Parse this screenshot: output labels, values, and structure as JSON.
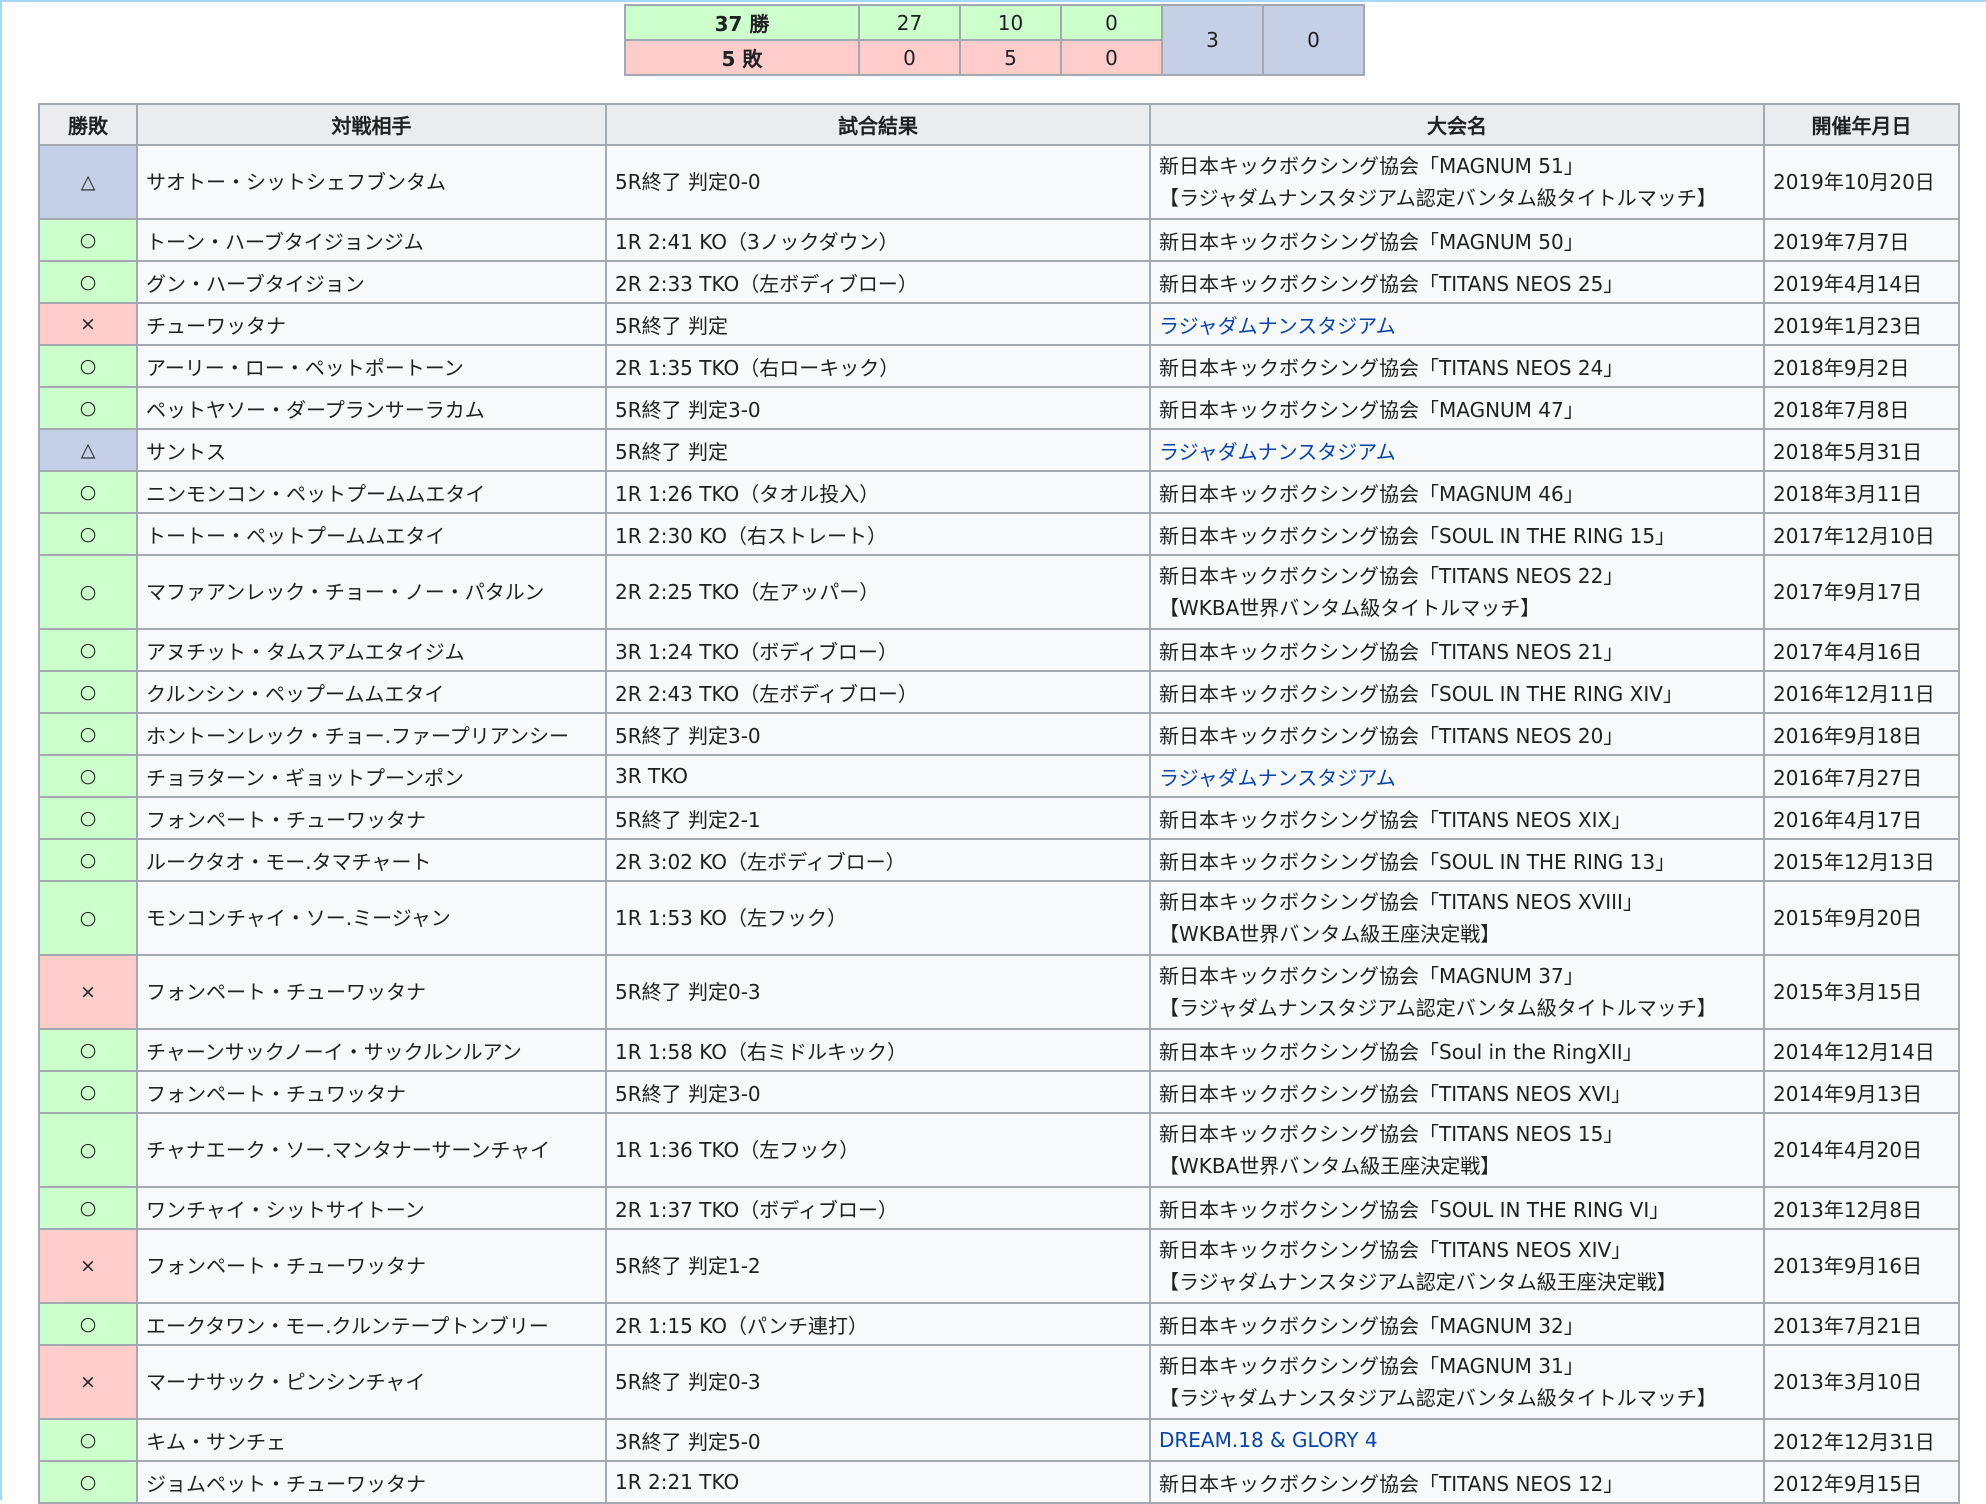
{
  "summary": {
    "wins_label": "37 勝",
    "wins_values": [
      "27",
      "10",
      "0"
    ],
    "losses_label": "5 敗",
    "losses_values": [
      "0",
      "5",
      "0"
    ],
    "draws": "3",
    "no_contest": "0"
  },
  "headers": [
    "勝敗",
    "対戦相手",
    "試合結果",
    "大会名",
    "開催年月日"
  ],
  "rows": [
    {
      "result": "△",
      "type": "d",
      "opponent": "サオトー・シットシェフブンタム",
      "outcome": "5R終了 判定0-0",
      "event": "新日本キックボクシング協会「MAGNUM 51」",
      "event_sub": "【ラジャダムナンスタジアム認定バンタム級タイトルマッチ】",
      "link": false,
      "date": "2019年10月20日"
    },
    {
      "result": "○",
      "type": "w",
      "opponent": "トーン・ハーブタイジョンジム",
      "outcome": "1R 2:41 KO（3ノックダウン）",
      "event": "新日本キックボクシング協会「MAGNUM 50」",
      "event_sub": "",
      "link": false,
      "date": "2019年7月7日"
    },
    {
      "result": "○",
      "type": "w",
      "opponent": "グン・ハーブタイジョン",
      "outcome": "2R 2:33 TKO（左ボディブロー）",
      "event": "新日本キックボクシング協会「TITANS NEOS 25」",
      "event_sub": "",
      "link": false,
      "date": "2019年4月14日"
    },
    {
      "result": "×",
      "type": "l",
      "opponent": "チューワッタナ",
      "outcome": "5R終了 判定",
      "event": "ラジャダムナンスタジアム",
      "event_sub": "",
      "link": true,
      "date": "2019年1月23日"
    },
    {
      "result": "○",
      "type": "w",
      "opponent": "アーリー・ロー・ペットポートーン",
      "outcome": "2R 1:35 TKO（右ローキック）",
      "event": "新日本キックボクシング協会「TITANS NEOS 24」",
      "event_sub": "",
      "link": false,
      "date": "2018年9月2日"
    },
    {
      "result": "○",
      "type": "w",
      "opponent": "ペットヤソー・ダープランサーラカム",
      "outcome": "5R終了 判定3-0",
      "event": "新日本キックボクシング協会「MAGNUM 47」",
      "event_sub": "",
      "link": false,
      "date": "2018年7月8日"
    },
    {
      "result": "△",
      "type": "d",
      "opponent": "サントス",
      "outcome": "5R終了 判定",
      "event": "ラジャダムナンスタジアム",
      "event_sub": "",
      "link": true,
      "date": "2018年5月31日"
    },
    {
      "result": "○",
      "type": "w",
      "opponent": "ニンモンコン・ペットプームムエタイ",
      "outcome": "1R 1:26 TKO（タオル投入）",
      "event": "新日本キックボクシング協会「MAGNUM 46」",
      "event_sub": "",
      "link": false,
      "date": "2018年3月11日"
    },
    {
      "result": "○",
      "type": "w",
      "opponent": "トートー・ペットプームムエタイ",
      "outcome": "1R 2:30 KO（右ストレート）",
      "event": "新日本キックボクシング協会「SOUL IN THE RING 15」",
      "event_sub": "",
      "link": false,
      "date": "2017年12月10日"
    },
    {
      "result": "○",
      "type": "w",
      "opponent": "マファアンレック・チョー・ノー・パタルン",
      "outcome": "2R 2:25 TKO（左アッパー）",
      "event": "新日本キックボクシング協会「TITANS NEOS 22」",
      "event_sub": "【WKBA世界バンタム級タイトルマッチ】",
      "link": false,
      "date": "2017年9月17日"
    },
    {
      "result": "○",
      "type": "w",
      "opponent": "アヌチット・タムスアムエタイジム",
      "outcome": "3R 1:24 TKO（ボディブロー）",
      "event": "新日本キックボクシング協会「TITANS NEOS 21」",
      "event_sub": "",
      "link": false,
      "date": "2017年4月16日"
    },
    {
      "result": "○",
      "type": "w",
      "opponent": "クルンシン・ペップームムエタイ",
      "outcome": "2R 2:43 TKO（左ボディブロー）",
      "event": "新日本キックボクシング協会「SOUL IN THE RING XIV」",
      "event_sub": "",
      "link": false,
      "date": "2016年12月11日"
    },
    {
      "result": "○",
      "type": "w",
      "opponent": "ホントーンレック・チョー.ファープリアンシー",
      "outcome": "5R終了 判定3-0",
      "event": "新日本キックボクシング協会「TITANS NEOS 20」",
      "event_sub": "",
      "link": false,
      "date": "2016年9月18日"
    },
    {
      "result": "○",
      "type": "w",
      "opponent": "チョラターン・ギョットプーンポン",
      "outcome": "3R TKO",
      "event": "ラジャダムナンスタジアム",
      "event_sub": "",
      "link": true,
      "date": "2016年7月27日"
    },
    {
      "result": "○",
      "type": "w",
      "opponent": "フォンペート・チューワッタナ",
      "outcome": "5R終了 判定2-1",
      "event": "新日本キックボクシング協会「TITANS NEOS XIX」",
      "event_sub": "",
      "link": false,
      "date": "2016年4月17日"
    },
    {
      "result": "○",
      "type": "w",
      "opponent": "ルークタオ・モー.タマチャート",
      "outcome": "2R 3:02 KO（左ボディブロー）",
      "event": "新日本キックボクシング協会「SOUL IN THE RING 13」",
      "event_sub": "",
      "link": false,
      "date": "2015年12月13日"
    },
    {
      "result": "○",
      "type": "w",
      "opponent": "モンコンチャイ・ソー.ミージャン",
      "outcome": "1R 1:53 KO（左フック）",
      "event": "新日本キックボクシング協会「TITANS NEOS XVIII」",
      "event_sub": "【WKBA世界バンタム級王座決定戦】",
      "link": false,
      "date": "2015年9月20日"
    },
    {
      "result": "×",
      "type": "l",
      "opponent": "フォンペート・チューワッタナ",
      "outcome": "5R終了 判定0-3",
      "event": "新日本キックボクシング協会「MAGNUM 37」",
      "event_sub": "【ラジャダムナンスタジアム認定バンタム級タイトルマッチ】",
      "link": false,
      "date": "2015年3月15日"
    },
    {
      "result": "○",
      "type": "w",
      "opponent": "チャーンサックノーイ・サックルンルアン",
      "outcome": "1R 1:58 KO（右ミドルキック）",
      "event": "新日本キックボクシング協会「Soul in the RingXII」",
      "event_sub": "",
      "link": false,
      "date": "2014年12月14日"
    },
    {
      "result": "○",
      "type": "w",
      "opponent": "フォンペート・チュワッタナ",
      "outcome": "5R終了 判定3-0",
      "event": "新日本キックボクシング協会「TITANS NEOS XVI」",
      "event_sub": "",
      "link": false,
      "date": "2014年9月13日"
    },
    {
      "result": "○",
      "type": "w",
      "opponent": "チャナエーク・ソー.マンタナーサーンチャイ",
      "outcome": "1R 1:36 TKO（左フック）",
      "event": "新日本キックボクシング協会「TITANS NEOS 15」",
      "event_sub": "【WKBA世界バンタム級王座決定戦】",
      "link": false,
      "date": "2014年4月20日"
    },
    {
      "result": "○",
      "type": "w",
      "opponent": "ワンチャイ・シットサイトーン",
      "outcome": "2R 1:37 TKO（ボディブロー）",
      "event": "新日本キックボクシング協会「SOUL IN THE RING VI」",
      "event_sub": "",
      "link": false,
      "date": "2013年12月8日"
    },
    {
      "result": "×",
      "type": "l",
      "opponent": "フォンペート・チューワッタナ",
      "outcome": "5R終了 判定1-2",
      "event": "新日本キックボクシング協会「TITANS NEOS XIV」",
      "event_sub": "【ラジャダムナンスタジアム認定バンタム級王座決定戦】",
      "link": false,
      "date": "2013年9月16日"
    },
    {
      "result": "○",
      "type": "w",
      "opponent": "エークタワン・モー.クルンテープトンブリー",
      "outcome": "2R 1:15 KO（パンチ連打）",
      "event": "新日本キックボクシング協会「MAGNUM 32」",
      "event_sub": "",
      "link": false,
      "date": "2013年7月21日"
    },
    {
      "result": "×",
      "type": "l",
      "opponent": "マーナサック・ピンシンチャイ",
      "outcome": "5R終了 判定0-3",
      "event": "新日本キックボクシング協会「MAGNUM 31」",
      "event_sub": "【ラジャダムナンスタジアム認定バンタム級タイトルマッチ】",
      "link": false,
      "date": "2013年3月10日"
    },
    {
      "result": "○",
      "type": "w",
      "opponent": "キム・サンチェ",
      "outcome": "3R終了 判定5-0",
      "event": "DREAM.18 & GLORY 4",
      "event_sub": "",
      "link": true,
      "date": "2012年12月31日"
    },
    {
      "result": "○",
      "type": "w",
      "opponent": "ジョムペット・チューワッタナ",
      "outcome": "1R 2:21 TKO",
      "event": "新日本キックボクシング協会「TITANS NEOS 12」",
      "event_sub": "",
      "link": false,
      "date": "2012年9月15日"
    }
  ]
}
